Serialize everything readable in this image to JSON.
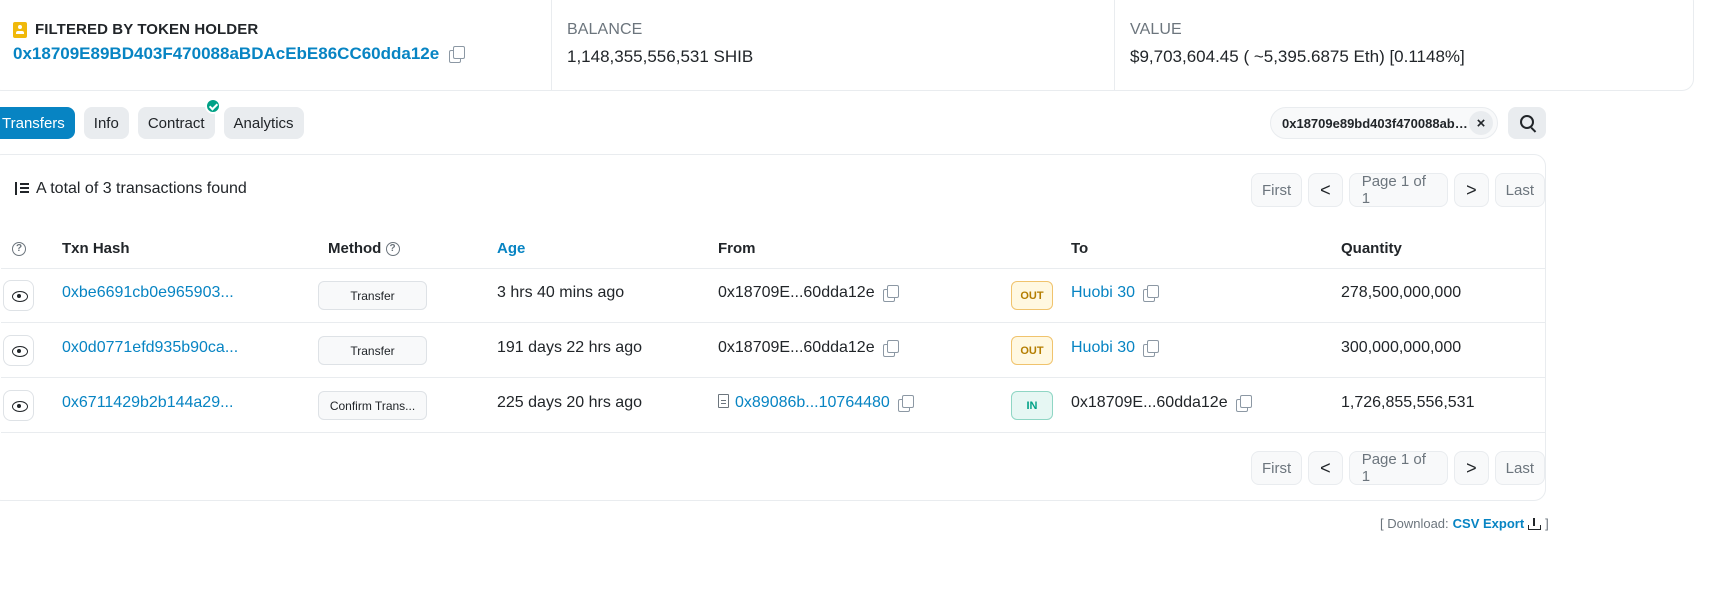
{
  "summary": {
    "holder_label": "FILTERED BY TOKEN HOLDER",
    "holder_address": "0x18709E89BD403F470088aBDAcEbE86CC60dda12e",
    "balance_label": "BALANCE",
    "balance_value": "1,148,355,556,531 SHIB",
    "value_label": "VALUE",
    "value_value": "$9,703,604.45 ( ~5,395.6875 Eth) [0.1148%]"
  },
  "tabs": [
    {
      "label": "Transfers",
      "active": true
    },
    {
      "label": "Info",
      "active": false
    },
    {
      "label": "Contract",
      "active": false,
      "verified": true
    },
    {
      "label": "Analytics",
      "active": false
    }
  ],
  "filter": {
    "value": "0x18709e89bd403f470088abd...",
    "clear_icon": "close-icon",
    "search_icon": "search-icon"
  },
  "table": {
    "total_text": "A total of 3 transactions found",
    "pager": {
      "first": "First",
      "prev": "<",
      "info": "Page 1 of 1",
      "next": ">",
      "last": "Last"
    },
    "headers": {
      "help": "?",
      "txn_hash": "Txn Hash",
      "method": "Method",
      "age": "Age",
      "from": "From",
      "to": "To",
      "quantity": "Quantity"
    },
    "rows": [
      {
        "hash": "0xbe6691cb0e965903...",
        "method": "Transfer",
        "age": "3 hrs 40 mins ago",
        "from": "0x18709E...60dda12e",
        "from_is_link": false,
        "direction": "OUT",
        "to": "Huobi 30",
        "to_is_link": true,
        "quantity": "278,500,000,000"
      },
      {
        "hash": "0x0d0771efd935b90ca...",
        "method": "Transfer",
        "age": "191 days 22 hrs ago",
        "from": "0x18709E...60dda12e",
        "from_is_link": false,
        "direction": "OUT",
        "to": "Huobi 30",
        "to_is_link": true,
        "quantity": "300,000,000,000"
      },
      {
        "hash": "0x6711429b2b144a29...",
        "method": "Confirm Trans...",
        "age": "225 days 20 hrs ago",
        "from": "0x89086b...10764480",
        "from_is_link": true,
        "direction": "IN",
        "to": "0x18709E...60dda12e",
        "to_is_link": false,
        "quantity": "1,726,855,556,531"
      }
    ]
  },
  "download": {
    "prefix": "[ Download:",
    "link": "CSV Export",
    "suffix": "]"
  },
  "colors": {
    "accent": "#0784c3",
    "verified": "#00a186",
    "out": "#b47d00",
    "in": "#00a186"
  }
}
